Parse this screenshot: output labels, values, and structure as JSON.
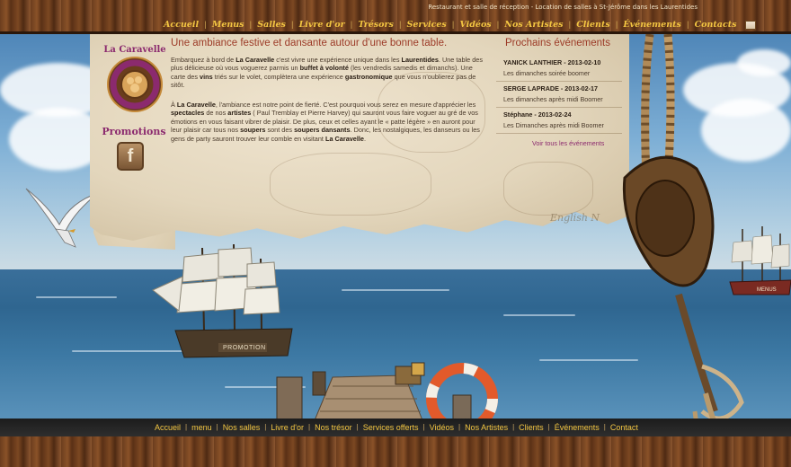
{
  "header": {
    "tagline": "Restaurant et salle de réception - Location de salles à St-Jérôme dans les Laurentides",
    "nav": [
      "Accueil",
      "Menus",
      "Salles",
      "Livre d'or",
      "Trésors",
      "Services",
      "Vidéos",
      "Nos Artistes",
      "Clients",
      "Événements",
      "Contacts"
    ]
  },
  "footer": {
    "nav": [
      "Accueil",
      "menu",
      "Nos salles",
      "Livre d'or",
      "Nos trésor",
      "Services offerts",
      "Vidéos",
      "Nos Artistes",
      "Clients",
      "Événements",
      "Contact"
    ]
  },
  "logo": {
    "name": "La Caravelle",
    "ring_text": "PARTY · SALLE · BISTRO · RESTAURANT"
  },
  "promotions": {
    "title": "Promotions",
    "facebook_label": "f"
  },
  "main": {
    "headline": "Une ambiance festive et dansante autour d'une bonne table.",
    "p1_prefix": "Embarquez à bord de ",
    "p1_name": "La Caravelle",
    "p1_a": " c'est vivre une expérience unique dans les ",
    "p1_laurentides": "Laurentides",
    "p1_b": ". Une table des plus délicieuse où vous voguerez parmis un ",
    "p1_buffet": "buffet à volonté",
    "p1_c": " (les vendredis samedis et dimanchs). Une carte des ",
    "p1_vins": "vins",
    "p1_d": " triés sur le volet, complètera une expérience ",
    "p1_gastro": "gastronomique",
    "p1_e": " que vous n'oublierez pas de sitôt.",
    "p2_prefix": "À ",
    "p2_name": "La Caravelle",
    "p2_a": ", l'ambiance est notre point de fierté. C'est pourquoi vous serez en mesure d'apprécier les ",
    "p2_spectacles": "spectacles",
    "p2_b": " de nos ",
    "p2_artistes": "artistes",
    "p2_c": " ( Paul Tremblay et Pierre Harvey) qui sauront vous faire voguer au gré de vos émotions en vous faisant vibrer de plaisir. De plus, ceux et celles ayant le « patte légère » en auront pour leur plaisir car tous nos ",
    "p2_soupers": "soupers",
    "p2_d": " sont des ",
    "p2_soupers_dansants": "soupers dansants",
    "p2_e": ". Donc, les nostalgiques, les danseurs ou les gens de party sauront trouver leur comble en visitant ",
    "p2_end": "La Caravelle",
    "p2_dot": "."
  },
  "events": {
    "title": "Prochains événements",
    "items": [
      {
        "head": "YANICK LANTHIER - 2013-02-10",
        "body": "Les dimanches soirée boomer"
      },
      {
        "head": "SERGE LAPRADE - 2013-02-17",
        "body": "Les dimanches après midi Boomer"
      },
      {
        "head": "Stéphane - 2013-02-24",
        "body": "Les Dimanches après midi Boomer"
      }
    ],
    "all_link": "Voir tous les événements"
  },
  "scene": {
    "ship_plaque": "PROMOTION",
    "distant_ship_label": "MENUS",
    "map_label": "English N"
  },
  "colors": {
    "nav_gold": "#f3c642",
    "accent_red": "#9c3a27",
    "logo_purple": "#8b2a6e"
  }
}
